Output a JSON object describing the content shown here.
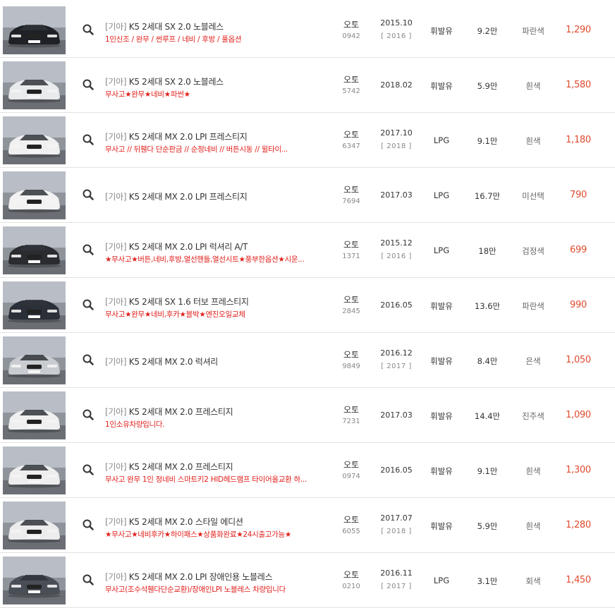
{
  "listings": [
    {
      "make": "[기아]",
      "title": "K5 2세대 SX 2.0 노블레스",
      "subtitle": "1인신조 / 완무 / 썬루프 / 네비 / 후방 / 풀옵션",
      "transmission": "오토",
      "code": "0942",
      "reg_date": "2015.10",
      "model_year": "[ 2016 ]",
      "fuel": "휘발유",
      "mileage": "9.2만",
      "color": "파란색",
      "price": "1,290",
      "car_color": "#1f2126"
    },
    {
      "make": "[기아]",
      "title": "K5 2세대 SX 2.0 노블레스",
      "subtitle": "무사고★완무★네비★파썬★",
      "transmission": "오토",
      "code": "5742",
      "reg_date": "2018.02",
      "model_year": "",
      "fuel": "휘발유",
      "mileage": "5.9만",
      "color": "흰색",
      "price": "1,580",
      "car_color": "#e9eaec"
    },
    {
      "make": "[기아]",
      "title": "K5 2세대 MX 2.0 LPI 프레스티지",
      "subtitle": "무사고 // 뒤휀다 단순판금 // 순정네비 // 버튼시동 // 윌타이...",
      "transmission": "오토",
      "code": "6347",
      "reg_date": "2017.10",
      "model_year": "[ 2018 ]",
      "fuel": "LPG",
      "mileage": "9.1만",
      "color": "흰색",
      "price": "1,180",
      "car_color": "#f0f0f0"
    },
    {
      "make": "[기아]",
      "title": "K5 2세대 MX 2.0 LPI 프레스티지",
      "subtitle": "",
      "transmission": "오토",
      "code": "7694",
      "reg_date": "2017.03",
      "model_year": "",
      "fuel": "LPG",
      "mileage": "16.7만",
      "color": "미선택",
      "price": "790",
      "car_color": "#f2f2f2"
    },
    {
      "make": "[기아]",
      "title": "K5 2세대 MX 2.0 LPI 럭셔리 A/T",
      "subtitle": "★무사고★버튼,네비,후방,열선핸들,열선시트★풍부한옵션★시운...",
      "transmission": "오토",
      "code": "1371",
      "reg_date": "2015.12",
      "model_year": "[ 2016 ]",
      "fuel": "LPG",
      "mileage": "18만",
      "color": "검정색",
      "price": "699",
      "car_color": "#2a2c30"
    },
    {
      "make": "[기아]",
      "title": "K5 2세대 SX 1.6 터보 프레스티지",
      "subtitle": "무사고★완무★네비,후카★블박★엔진오일교체",
      "transmission": "오토",
      "code": "2845",
      "reg_date": "2016.05",
      "model_year": "",
      "fuel": "휘발유",
      "mileage": "13.6만",
      "color": "파란색",
      "price": "990",
      "car_color": "#2b3038"
    },
    {
      "make": "[기아]",
      "title": "K5 2세대 MX 2.0 럭셔리",
      "subtitle": "",
      "transmission": "오토",
      "code": "9849",
      "reg_date": "2016.12",
      "model_year": "[ 2017 ]",
      "fuel": "휘발유",
      "mileage": "8.4만",
      "color": "은색",
      "price": "1,050",
      "car_color": "#c9ccd0"
    },
    {
      "make": "[기아]",
      "title": "K5 2세대 MX 2.0 프레스티지",
      "subtitle": "1인소유차량입니다.",
      "transmission": "오토",
      "code": "7231",
      "reg_date": "2017.03",
      "model_year": "",
      "fuel": "휘발유",
      "mileage": "14.4만",
      "color": "진주색",
      "price": "1,090",
      "car_color": "#efefef"
    },
    {
      "make": "[기아]",
      "title": "K5 2세대 MX 2.0 프레스티지",
      "subtitle": "무사고 완무 1인 정네비 스마트키2 HID헤드램프 타이어올교환 하...",
      "transmission": "오토",
      "code": "0974",
      "reg_date": "2016.05",
      "model_year": "",
      "fuel": "휘발유",
      "mileage": "9.1만",
      "color": "흰색",
      "price": "1,300",
      "car_color": "#eeeeee"
    },
    {
      "make": "[기아]",
      "title": "K5 2세대 MX 2.0 스타일 에디션",
      "subtitle": "★무사고★네비후카★하이패스★상품화완료★24시출고가능★",
      "transmission": "오토",
      "code": "6055",
      "reg_date": "2017.07",
      "model_year": "[ 2018 ]",
      "fuel": "휘발유",
      "mileage": "5.9만",
      "color": "흰색",
      "price": "1,280",
      "car_color": "#ececec"
    },
    {
      "make": "[기아]",
      "title": "K5 2세대 MX 2.0 LPI 장애인용 노블레스",
      "subtitle": "무사고(조수석휀다단순교환)/장애인LPI 노블레스 차량입니다",
      "transmission": "오토",
      "code": "0210",
      "reg_date": "2016.11",
      "model_year": "[ 2017 ]",
      "fuel": "LPG",
      "mileage": "3.1만",
      "color": "회색",
      "price": "1,450",
      "car_color": "#4a4e56"
    }
  ]
}
